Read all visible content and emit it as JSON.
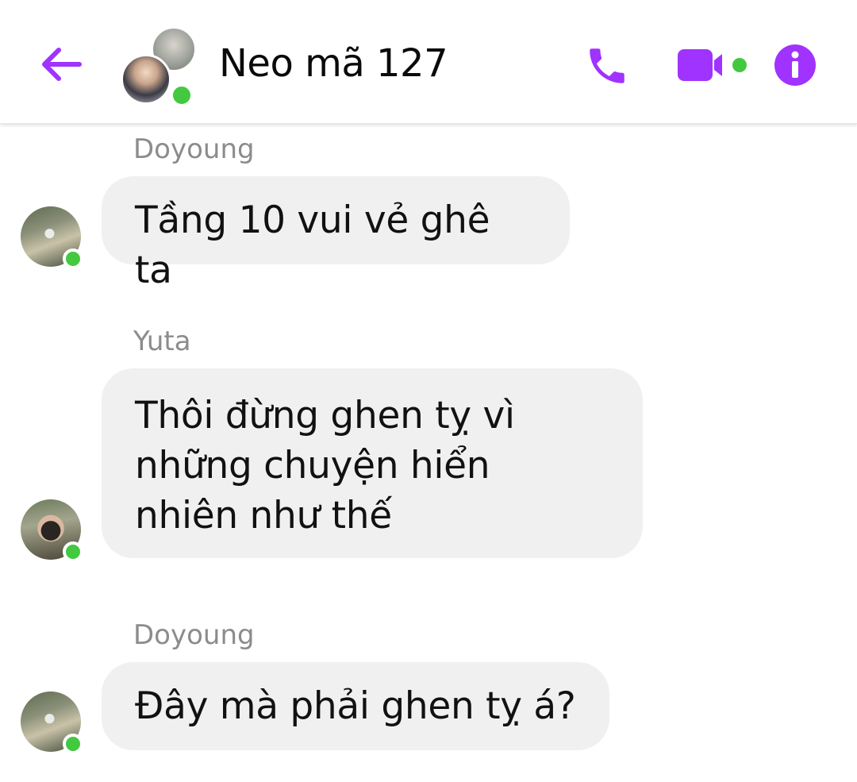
{
  "header": {
    "title": "Neo mã 127",
    "icons": {
      "back": "back-arrow-icon",
      "call": "phone-icon",
      "video": "video-camera-icon",
      "info": "info-icon"
    },
    "accent_color": "#a033ff",
    "online_color": "#42c93f"
  },
  "messages": [
    {
      "sender": "Doyoung",
      "lines": [
        "Tầng 10 vui vẻ ghê ta"
      ]
    },
    {
      "sender": "Yuta",
      "lines": [
        "Thôi đừng ghen tỵ vì",
        "những chuyện hiển",
        "nhiên như thế"
      ]
    },
    {
      "sender": "Doyoung",
      "lines": [
        "Đây mà phải ghen tỵ á?"
      ]
    }
  ]
}
